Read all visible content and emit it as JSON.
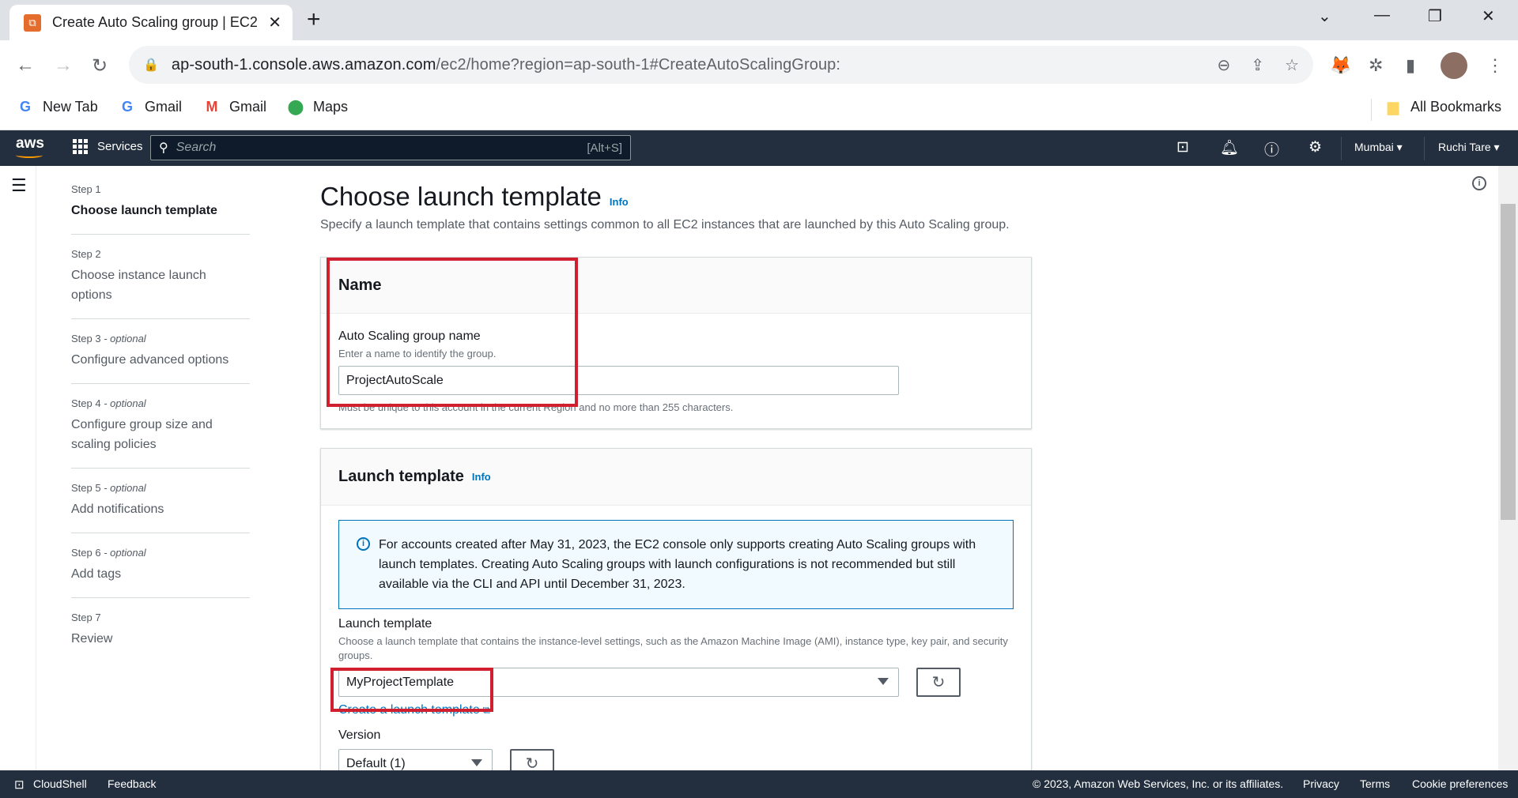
{
  "browser": {
    "tab_title": "Create Auto Scaling group | EC2",
    "url_host": "ap-south-1.console.aws.amazon.com",
    "url_path": "/ec2/home?region=ap-south-1#CreateAutoScalingGroup:",
    "bookmarks": [
      "New Tab",
      "Gmail",
      "Gmail",
      "Maps"
    ],
    "all_bookmarks": "All Bookmarks"
  },
  "aws_nav": {
    "logo": "aws",
    "services": "Services",
    "search_placeholder": "Search",
    "search_shortcut": "[Alt+S]",
    "region": "Mumbai ▾",
    "user": "Ruchi Tare ▾"
  },
  "steps": [
    {
      "num": "Step 1",
      "optional": "",
      "title": "Choose launch template"
    },
    {
      "num": "Step 2",
      "optional": "",
      "title": "Choose instance launch options"
    },
    {
      "num": "Step 3",
      "optional": " - optional",
      "title": "Configure advanced options"
    },
    {
      "num": "Step 4",
      "optional": " - optional",
      "title": "Configure group size and scaling policies"
    },
    {
      "num": "Step 5",
      "optional": " - optional",
      "title": "Add notifications"
    },
    {
      "num": "Step 6",
      "optional": " - optional",
      "title": "Add tags"
    },
    {
      "num": "Step 7",
      "optional": "",
      "title": "Review"
    }
  ],
  "page": {
    "title": "Choose launch template",
    "info": "Info",
    "description": "Specify a launch template that contains settings common to all EC2 instances that are launched by this Auto Scaling group."
  },
  "name_panel": {
    "title": "Name",
    "field_label": "Auto Scaling group name",
    "field_hint": "Enter a name to identify the group.",
    "field_value": "ProjectAutoScale",
    "constraint": "Must be unique to this account in the current Region and no more than 255 characters."
  },
  "launch_panel": {
    "title": "Launch template",
    "info": "Info",
    "alert": "For accounts created after May 31, 2023, the EC2 console only supports creating Auto Scaling groups with launch templates. Creating Auto Scaling groups with launch configurations is not recommended but still available via the CLI and API until December 31, 2023.",
    "field_label": "Launch template",
    "field_hint": "Choose a launch template that contains the instance-level settings, such as the Amazon Machine Image (AMI), instance type, key pair, and security groups.",
    "selected": "MyProjectTemplate",
    "create_link": "Create a launch template",
    "version_label": "Version",
    "version_selected": "Default (1)"
  },
  "footer": {
    "cloudshell": "CloudShell",
    "feedback": "Feedback",
    "copyright": "© 2023, Amazon Web Services, Inc. or its affiliates.",
    "privacy": "Privacy",
    "terms": "Terms",
    "cookies": "Cookie preferences"
  }
}
